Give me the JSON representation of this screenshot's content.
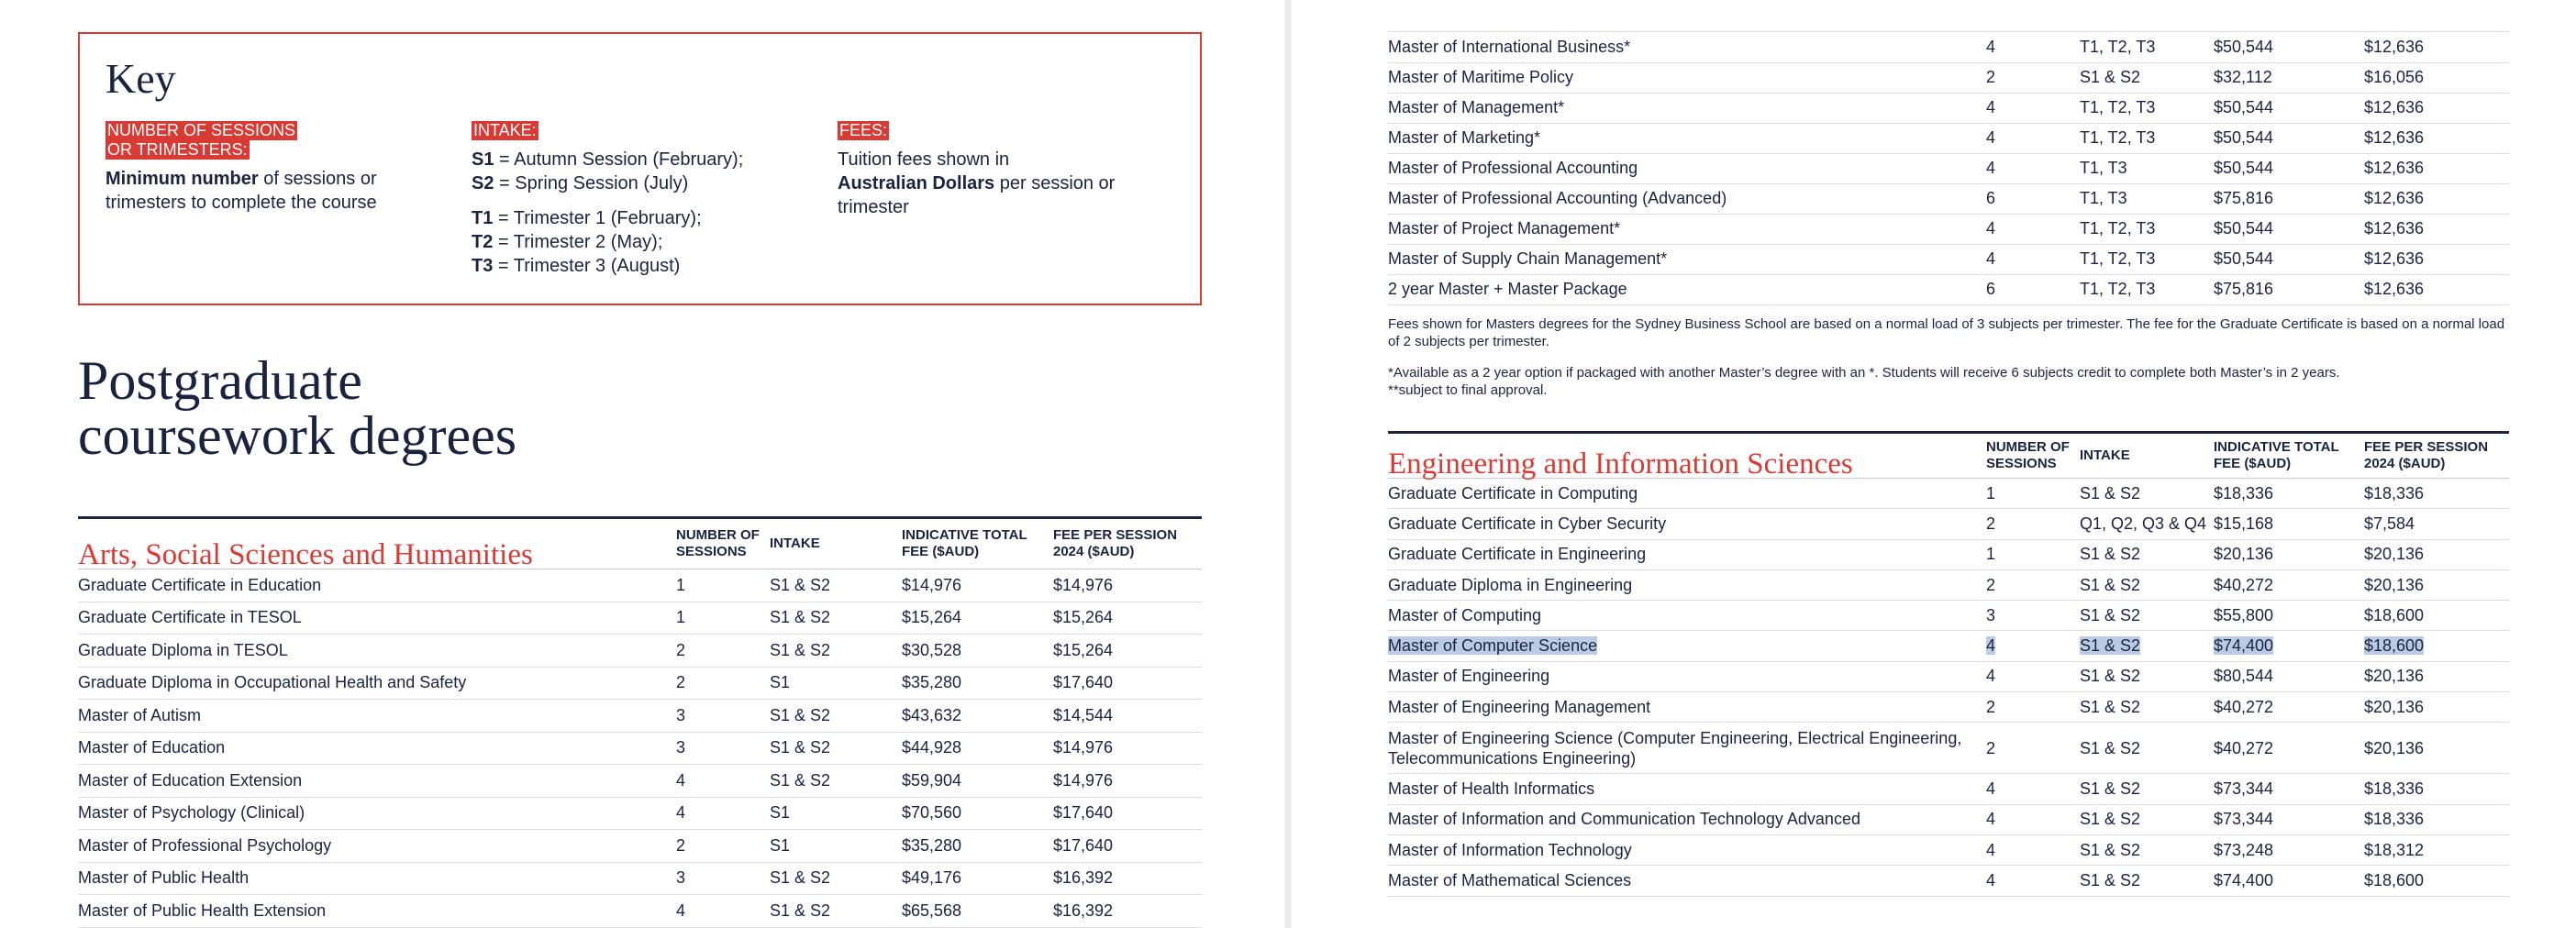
{
  "key": {
    "title": "Key",
    "sessions_tag_line1": "NUMBER OF SESSIONS",
    "sessions_tag_line2": "OR TRIMESTERS:",
    "sessions_desc_bold": "Minimum number",
    "sessions_desc_rest": " of sessions or trimesters to complete the course",
    "intake_tag": "INTAKE:",
    "s1_code": "S1",
    "s1_desc": " = Autumn Session (February);",
    "s2_code": "S2",
    "s2_desc": " = Spring Session (July)",
    "t1_code": "T1",
    "t1_desc": " = Trimester 1 (February);",
    "t2_code": "T2",
    "t2_desc": " = Trimester 2 (May);",
    "t3_code": "T3",
    "t3_desc": " = Trimester 3 (August)",
    "fees_tag": "FEES:",
    "fees_desc_pre": "Tuition fees  shown in ",
    "fees_desc_bold": "Australian Dollars",
    "fees_desc_post": " per session or trimester"
  },
  "page_title_line1": "Postgraduate",
  "page_title_line2": "coursework degrees",
  "columns": {
    "sessions_l1": "NUMBER OF",
    "sessions_l2": "SESSIONS",
    "intake": "INTAKE",
    "total_l1": "INDICATIVE TOTAL",
    "total_l2": "FEE ($AUD)",
    "per_l1": "FEE PER SESSION",
    "per_l2": "2024 ($AUD)"
  },
  "arts": {
    "title": "Arts, Social Sciences and Humanities",
    "rows": [
      {
        "name": "Graduate Certificate in Education",
        "sessions": "1",
        "intake": "S1 & S2",
        "total": "$14,976",
        "per": "$14,976"
      },
      {
        "name": "Graduate Certificate in TESOL",
        "sessions": "1",
        "intake": "S1 & S2",
        "total": "$15,264",
        "per": "$15,264"
      },
      {
        "name": "Graduate Diploma in TESOL",
        "sessions": "2",
        "intake": "S1 & S2",
        "total": "$30,528",
        "per": "$15,264"
      },
      {
        "name": "Graduate Diploma in Occupational Health and Safety",
        "sessions": "2",
        "intake": "S1",
        "total": "$35,280",
        "per": "$17,640"
      },
      {
        "name": "Master of Autism",
        "sessions": "3",
        "intake": "S1 & S2",
        "total": "$43,632",
        "per": "$14,544"
      },
      {
        "name": "Master of Education",
        "sessions": "3",
        "intake": "S1 & S2",
        "total": "$44,928",
        "per": "$14,976"
      },
      {
        "name": "Master of Education Extension",
        "sessions": "4",
        "intake": "S1 & S2",
        "total": "$59,904",
        "per": "$14,976"
      },
      {
        "name": "Master of Psychology (Clinical)",
        "sessions": "4",
        "intake": "S1",
        "total": "$70,560",
        "per": "$17,640"
      },
      {
        "name": "Master of Professional Psychology",
        "sessions": "2",
        "intake": "S1",
        "total": "$35,280",
        "per": "$17,640"
      },
      {
        "name": "Master of Public Health",
        "sessions": "3",
        "intake": "S1 & S2",
        "total": "$49,176",
        "per": "$16,392"
      },
      {
        "name": "Master of Public Health Extension",
        "sessions": "4",
        "intake": "S1 & S2",
        "total": "$65,568",
        "per": "$16,392"
      }
    ]
  },
  "business_masters": {
    "rows": [
      {
        "name": "Master of International Business*",
        "sessions": "4",
        "intake": "T1, T2, T3",
        "total": "$50,544",
        "per": "$12,636"
      },
      {
        "name": "Master of Maritime Policy",
        "sessions": "2",
        "intake": "S1 & S2",
        "total": "$32,112",
        "per": "$16,056"
      },
      {
        "name": "Master of Management*",
        "sessions": "4",
        "intake": "T1, T2, T3",
        "total": "$50,544",
        "per": "$12,636"
      },
      {
        "name": "Master of Marketing*",
        "sessions": "4",
        "intake": "T1, T2, T3",
        "total": "$50,544",
        "per": "$12,636"
      },
      {
        "name": "Master of Professional Accounting",
        "sessions": "4",
        "intake": "T1, T3",
        "total": "$50,544",
        "per": "$12,636"
      },
      {
        "name": "Master of Professional Accounting (Advanced)",
        "sessions": "6",
        "intake": "T1, T3",
        "total": "$75,816",
        "per": "$12,636"
      },
      {
        "name": "Master of Project Management*",
        "sessions": "4",
        "intake": "T1, T2, T3",
        "total": "$50,544",
        "per": "$12,636"
      },
      {
        "name": "Master of Supply Chain Management*",
        "sessions": "4",
        "intake": "T1, T2, T3",
        "total": "$50,544",
        "per": "$12,636"
      },
      {
        "name": "2 year Master + Master Package",
        "sessions": "6",
        "intake": "T1, T2, T3",
        "total": "$75,816",
        "per": "$12,636"
      }
    ],
    "note1": "Fees shown for Masters degrees for the Sydney Business School are based on a normal load of 3 subjects per trimester. The fee for the Graduate Certificate is based on a normal load of 2 subjects per trimester.",
    "note2_line1": "*Available as a 2 year option if packaged with another Master’s degree with an *. Students will receive 6 subjects credit to complete both Master’s in 2 years.",
    "note2_line2": "**subject to final approval."
  },
  "engineering": {
    "title": "Engineering and Information Sciences",
    "selected_row": "Master of Computer Science",
    "rows": [
      {
        "name": "Graduate Certificate in Computing",
        "sessions": "1",
        "intake": "S1 & S2",
        "total": "$18,336",
        "per": "$18,336"
      },
      {
        "name": "Graduate Certificate in Cyber Security",
        "sessions": "2",
        "intake": "Q1, Q2, Q3 & Q4",
        "total": "$15,168",
        "per": "$7,584"
      },
      {
        "name": "Graduate Certificate in Engineering",
        "sessions": "1",
        "intake": "S1 & S2",
        "total": "$20,136",
        "per": "$20,136"
      },
      {
        "name": "Graduate Diploma in Engineering",
        "sessions": "2",
        "intake": "S1 & S2",
        "total": "$40,272",
        "per": "$20,136"
      },
      {
        "name": "Master of Computing",
        "sessions": "3",
        "intake": "S1 & S2",
        "total": "$55,800",
        "per": "$18,600"
      },
      {
        "name": "Master of Computer Science",
        "sessions": "4",
        "intake": "S1 & S2",
        "total": "$74,400",
        "per": "$18,600"
      },
      {
        "name": "Master of Engineering",
        "sessions": "4",
        "intake": "S1 & S2",
        "total": "$80,544",
        "per": "$20,136"
      },
      {
        "name": "Master of Engineering Management",
        "sessions": "2",
        "intake": "S1 & S2",
        "total": "$40,272",
        "per": "$20,136"
      },
      {
        "name": "Master of Engineering Science (Computer Engineering, Electrical Engineering, Telecommunications Engineering)",
        "sessions": "2",
        "intake": "S1 & S2",
        "total": "$40,272",
        "per": "$20,136"
      },
      {
        "name": "Master of Health Informatics",
        "sessions": "4",
        "intake": "S1 & S2",
        "total": "$73,344",
        "per": "$18,336"
      },
      {
        "name": "Master of Information and Communication Technology Advanced",
        "sessions": "4",
        "intake": "S1 & S2",
        "total": "$73,344",
        "per": "$18,336"
      },
      {
        "name": "Master of Information Technology",
        "sessions": "4",
        "intake": "S1 & S2",
        "total": "$73,248",
        "per": "$18,312"
      },
      {
        "name": "Master of Mathematical Sciences",
        "sessions": "4",
        "intake": "S1 & S2",
        "total": "$74,400",
        "per": "$18,600"
      }
    ]
  }
}
